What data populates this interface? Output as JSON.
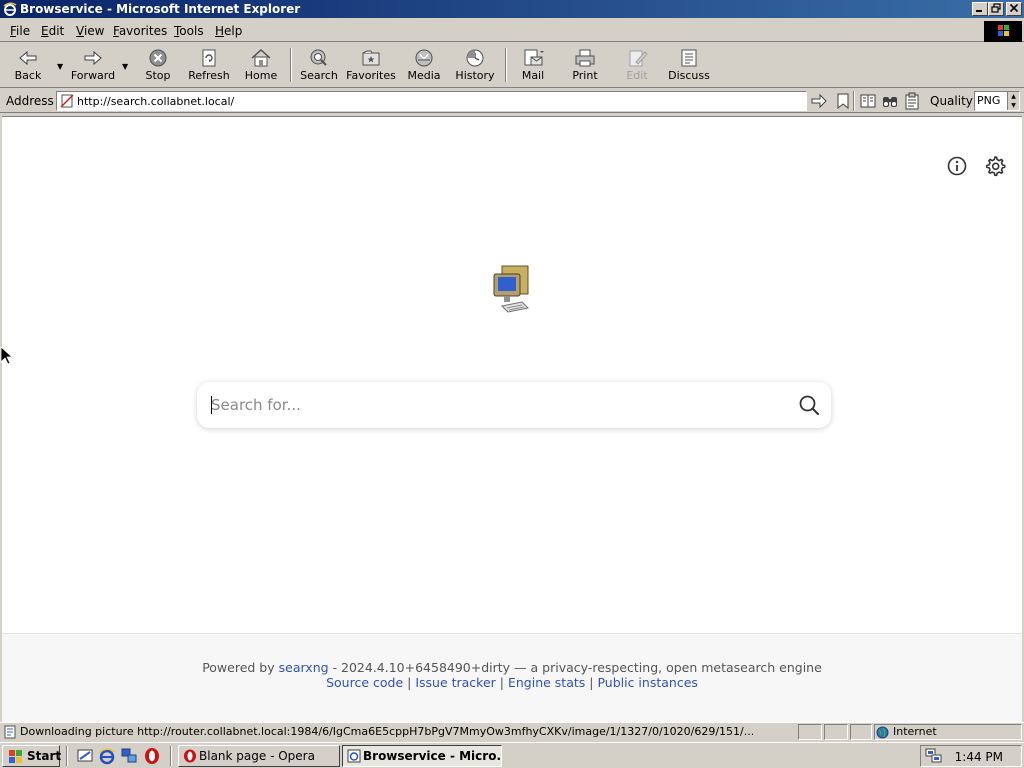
{
  "window": {
    "title": "Browservice - Microsoft Internet Explorer"
  },
  "menu": [
    {
      "label": "File",
      "key": "F",
      "rest": "ile"
    },
    {
      "label": "Edit",
      "key": "E",
      "rest": "dit"
    },
    {
      "label": "View",
      "key": "V",
      "rest": "iew"
    },
    {
      "label": "Favorites",
      "key": "F",
      "rest": "avorites"
    },
    {
      "label": "Tools",
      "key": "T",
      "rest": "ools"
    },
    {
      "label": "Help",
      "key": "H",
      "rest": "elp"
    }
  ],
  "toolbar": {
    "back": "Back",
    "forward": "Forward",
    "stop": "Stop",
    "refresh": "Refresh",
    "home": "Home",
    "search": "Search",
    "favorites": "Favorites",
    "media": "Media",
    "history": "History",
    "mail": "Mail",
    "print": "Print",
    "edit": "Edit",
    "discuss": "Discuss"
  },
  "address": {
    "label": "Address",
    "url": "http://search.collabnet.local/",
    "quality_label": "Quality",
    "quality_value": "PNG"
  },
  "page": {
    "search_placeholder": "Search for...",
    "footer": {
      "powered_by": "Powered by",
      "engine_link": "searxng",
      "version_text": " - 2024.4.10+6458490+dirty — a privacy-respecting, open metasearch engine",
      "links": [
        "Source code",
        "Issue tracker",
        "Engine stats",
        "Public instances"
      ],
      "separator": " | "
    }
  },
  "status": {
    "text": "Downloading picture http://router.collabnet.local:1984/6/IgCma6E5cppH7bPgV7MmyOw3mfhyCXKv/image/1/1327/0/1020/629/151/...",
    "zone": "Internet"
  },
  "taskbar": {
    "start": "Start",
    "tasks": [
      "Blank page - Opera",
      "Browservice - Micro..."
    ],
    "clock": "1:44 PM"
  },
  "colors": {
    "title_bar_start": "#0a246a",
    "title_bar_end": "#3a6ea5",
    "chrome": "#d4d0c8",
    "link": "#3050c0",
    "footer_bg": "#f7f7f8"
  }
}
